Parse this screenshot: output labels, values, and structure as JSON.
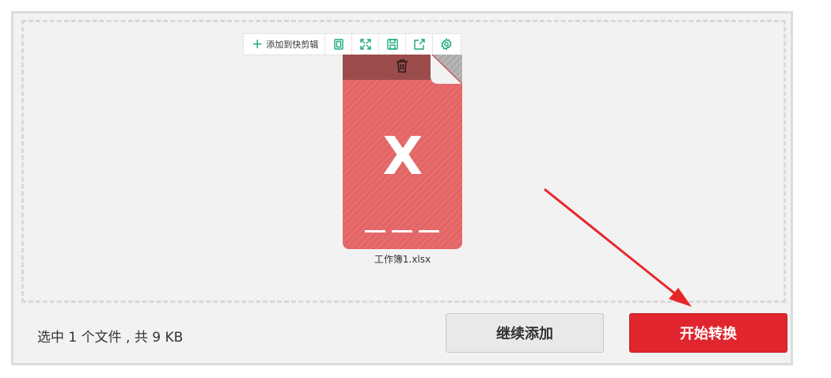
{
  "toolbar": {
    "add_to_quick_edit_label": "添加到快剪辑",
    "icons": [
      "copy-icon",
      "fullscreen-icon",
      "save-icon",
      "share-icon",
      "settings-icon"
    ]
  },
  "file": {
    "name": "工作簿1.xlsx",
    "type_letter": "X",
    "card_color": "#e36565",
    "delete_icon": "trash-icon"
  },
  "footer": {
    "status": "选中 1 个文件 , 共 9 KB",
    "continue_add_label": "继续添加",
    "start_convert_label": "开始转换"
  },
  "colors": {
    "accent_green": "#18a97a",
    "primary_red": "#e1252f",
    "annotation_arrow": "#e8262a"
  }
}
